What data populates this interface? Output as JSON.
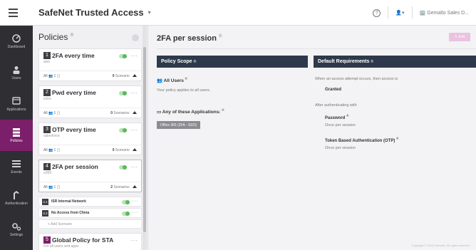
{
  "header": {
    "brand": "SafeNet Trusted Access",
    "account": "Gemalto Sales D..."
  },
  "nav": [
    {
      "label": "Dashboard",
      "icon": "dashboard-icon"
    },
    {
      "label": "Users",
      "icon": "users-icon"
    },
    {
      "label": "Applications",
      "icon": "applications-icon"
    },
    {
      "label": "Policies",
      "icon": "policies-icon",
      "active": true
    },
    {
      "label": "Events",
      "icon": "events-icon"
    },
    {
      "label": "Authentication",
      "icon": "authentication-icon"
    },
    {
      "label": "Settings",
      "icon": "settings-icon"
    }
  ],
  "policies": {
    "title": "Policies",
    "info": "®",
    "items": [
      {
        "num": "1",
        "name": "2FA every time",
        "sub": "aws",
        "foot": "All 👥 1 ▢",
        "scen_count": "0",
        "scen_label": "Scenario"
      },
      {
        "num": "2",
        "name": "Pwd every time",
        "sub": "zoho",
        "foot": "All 👥 1 ▢",
        "scen_count": "0",
        "scen_label": "Scenarios"
      },
      {
        "num": "3",
        "name": "OTP every time",
        "sub": "salesforce",
        "foot": "All 👥 1 ▢",
        "scen_count": "0",
        "scen_label": "Scenario"
      },
      {
        "num": "4",
        "name": "2FA per session",
        "sub": "o365",
        "foot": "All 👥 1 ▢",
        "scen_count": "2",
        "scen_label": "Scenarios"
      }
    ],
    "sub_rules": [
      {
        "num": "4.1",
        "name": "ISR Internal Network"
      },
      {
        "num": "4.2",
        "name": "No Access from China"
      }
    ],
    "add_scenario": "+ Add Scenario",
    "global": {
      "num": "5",
      "name": "Global Policy for STA",
      "sub": "For all users and apps"
    }
  },
  "main": {
    "title": "2FA per session",
    "info": "®",
    "edit_label": "✎ Edit",
    "scope": {
      "heading": "Policy Scope",
      "users_label": "All Users",
      "users_text": "Your policy applies to all users.",
      "apps_label": "Any of these Applications:",
      "app_chip": "Office 365 (2FA - SSO)"
    },
    "requirements": {
      "heading": "Default Requirements",
      "intro": "When an access attempt occurs, then access is",
      "granted": "Granted",
      "after": "After authenticating with",
      "password_label": "Password",
      "password_freq": "Once per session",
      "token_label": "Token Based Authentication (OTP)",
      "token_freq": "Once per session"
    },
    "footer": "Copyright © 2018 Gemalto. All rights reserved."
  }
}
